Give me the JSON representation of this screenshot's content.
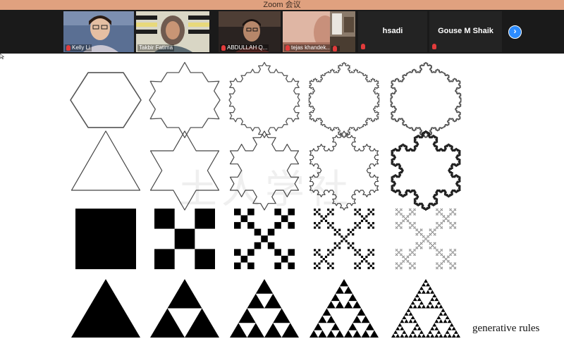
{
  "window": {
    "title": "Zoom 会议"
  },
  "participants": [
    {
      "name": "Kelly Li",
      "muted": true
    },
    {
      "name": "Takbir Fatima",
      "muted": false
    },
    {
      "name": "ABDULLAH Q...",
      "muted": true
    },
    {
      "name": "tejas khandek...",
      "muted": true
    },
    {
      "name": "",
      "muted": true
    },
    {
      "name": "hsadi",
      "muted": true
    },
    {
      "name": "Gouse M Shaik",
      "muted": true
    }
  ],
  "navigation": {
    "next_icon": "chevron-right-icon",
    "next_glyph": "›"
  },
  "whiteboard": {
    "watermark": "土人学社",
    "caption": "generative rules",
    "rows": [
      "koch snowflake (hexagon seed)",
      "koch snowflake (triangle seed)",
      "vicsek fractal",
      "sierpinski triangle"
    ],
    "iterations": 5
  },
  "colors": {
    "titlebar": "#e0a17f",
    "strip": "#1a1a1a",
    "accent": "#2d8cff",
    "muted_mic": "#e23b3b"
  }
}
